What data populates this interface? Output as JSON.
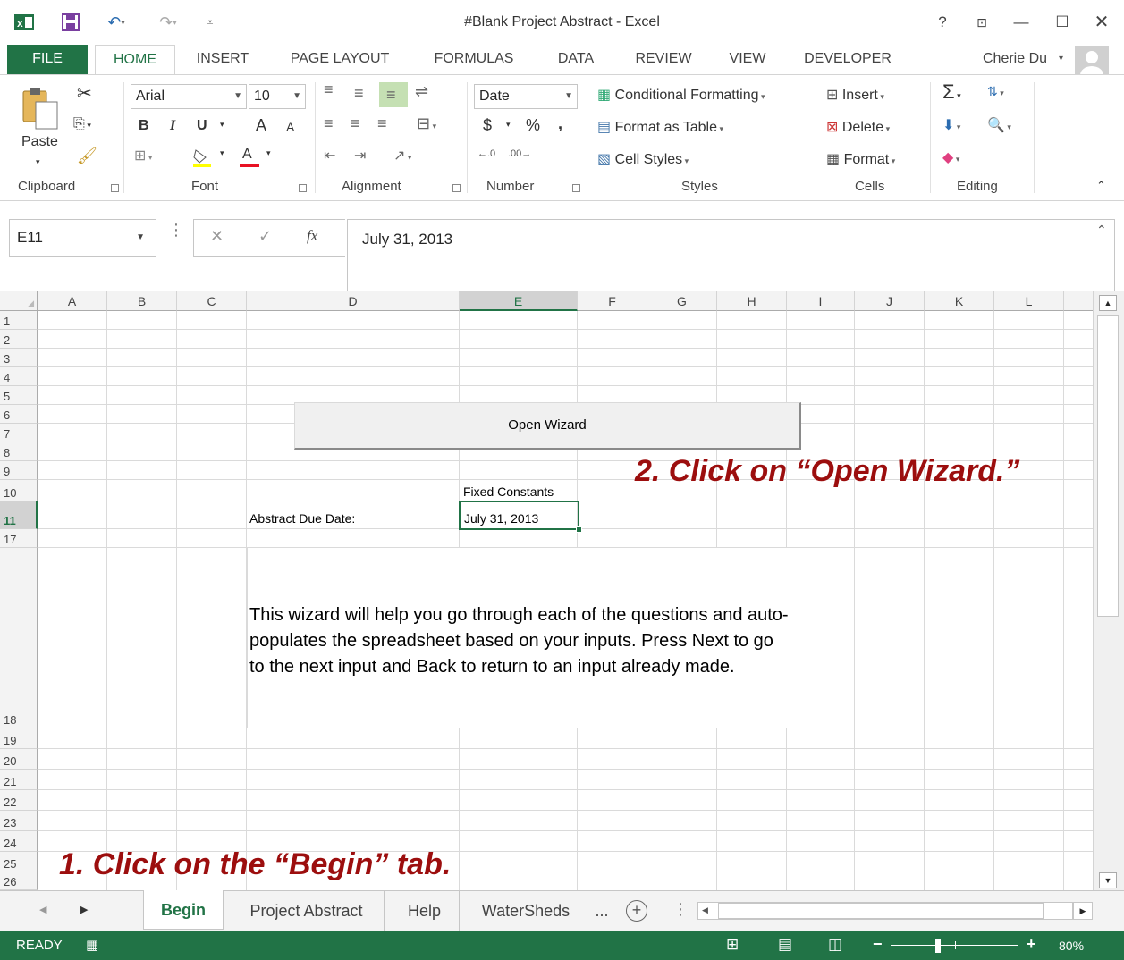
{
  "window": {
    "title": "#Blank Project Abstract - Excel",
    "help_glyph": "?",
    "user": "Cherie Du"
  },
  "ribbon_tabs": [
    "FILE",
    "HOME",
    "INSERT",
    "PAGE LAYOUT",
    "FORMULAS",
    "DATA",
    "REVIEW",
    "VIEW",
    "DEVELOPER"
  ],
  "ribbon": {
    "clipboard": {
      "paste": "Paste",
      "label": "Clipboard"
    },
    "font": {
      "name": "Arial",
      "size": "10",
      "bold": "B",
      "italic": "I",
      "underline": "U",
      "grow": "A",
      "shrink": "A",
      "color_a": "A",
      "label": "Font"
    },
    "alignment": {
      "label": "Alignment"
    },
    "number": {
      "format": "Date",
      "currency": "$",
      "percent": "%",
      "comma": ",",
      "label": "Number"
    },
    "styles": {
      "conditional": "Conditional Formatting",
      "format_table": "Format as Table",
      "cell_styles": "Cell Styles",
      "label": "Styles"
    },
    "cells": {
      "insert": "Insert",
      "delete": "Delete",
      "format": "Format",
      "label": "Cells"
    },
    "editing": {
      "label": "Editing"
    }
  },
  "formula_bar": {
    "name_box": "E11",
    "fx": "fx",
    "formula": "July 31, 2013"
  },
  "columns": [
    "A",
    "B",
    "C",
    "D",
    "E",
    "F",
    "G",
    "H",
    "I",
    "J",
    "K",
    "L"
  ],
  "rows": [
    "1",
    "2",
    "3",
    "4",
    "5",
    "6",
    "7",
    "8",
    "9",
    "10",
    "11",
    "17",
    "18",
    "19",
    "20",
    "21",
    "22",
    "23",
    "24",
    "25",
    "26"
  ],
  "cells": {
    "open_wizard": "Open Wizard",
    "fixed_constants": "Fixed Constants",
    "due_date_label": "Abstract Due Date:",
    "due_date_value": "July 31, 2013",
    "wizard_text": [
      "This wizard will help you go through each of the questions and auto-",
      "populates the spreadsheet based on your inputs.  Press Next to go",
      "to the next input and Back to return to an input already made."
    ]
  },
  "annotations": {
    "step1": "1.  Click on the “Begin” tab.",
    "step2": "2.  Click on “Open Wizard.”",
    "color": "#9c0e0e"
  },
  "sheet_tabs": [
    "Begin",
    "Project Abstract",
    "Help",
    "WaterSheds"
  ],
  "sheet_tabs_more": "...",
  "status": {
    "ready": "READY",
    "zoom": "80%"
  },
  "colors": {
    "excel_green": "#217346",
    "header_bg": "#f3f3f3"
  }
}
